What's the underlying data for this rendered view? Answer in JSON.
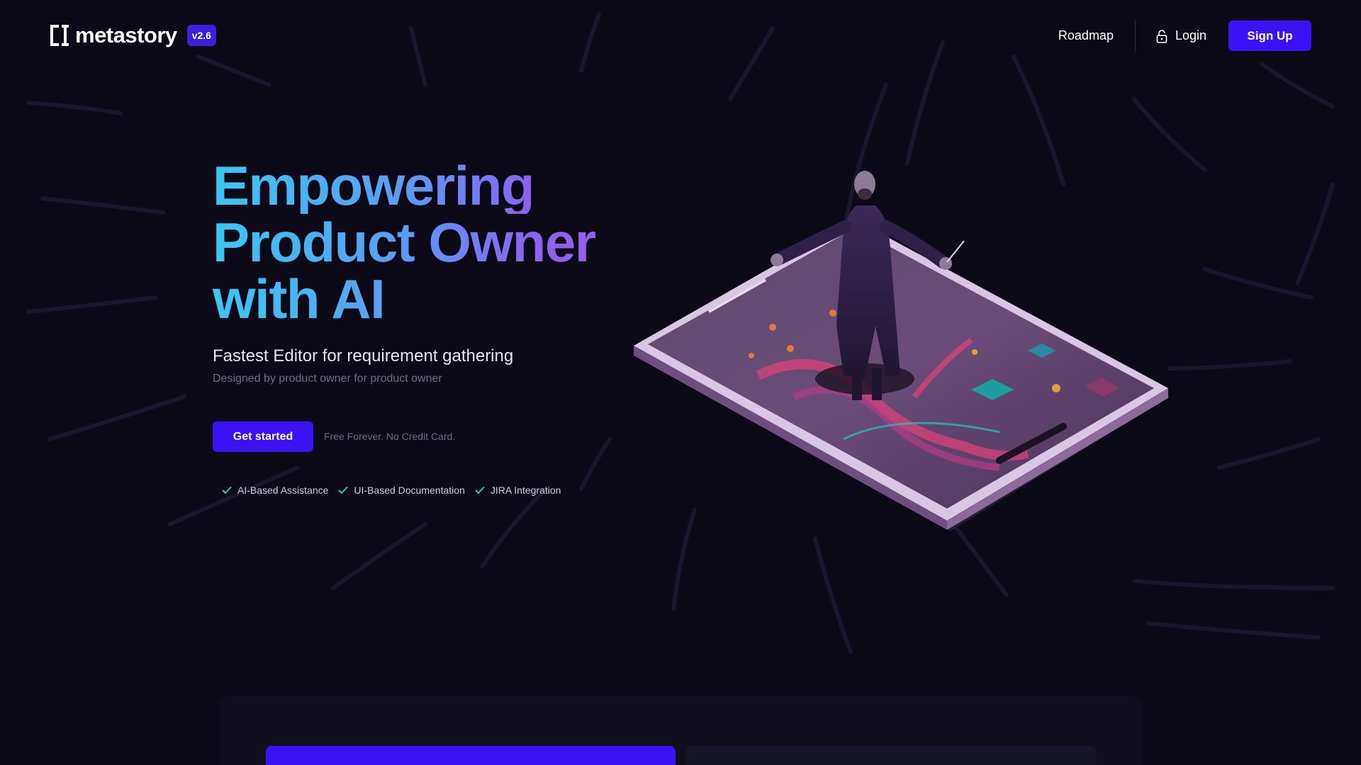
{
  "header": {
    "logo_text": "metastory",
    "version": "v2.6",
    "nav": {
      "roadmap": "Roadmap",
      "login": "Login",
      "signup": "Sign Up"
    }
  },
  "hero": {
    "title_lines": [
      "Empowering",
      "Product Owner",
      "with AI"
    ],
    "subtitle": "Fastest Editor for requirement gathering",
    "tagline": "Designed by product owner for product owner",
    "cta_label": "Get started",
    "cta_note": "Free Forever. No Credit Card.",
    "features": [
      "AI-Based Assistance",
      "UI-Based Documentation",
      "JIRA Integration"
    ]
  },
  "colors": {
    "background": "#0b0a16",
    "accent": "#3a12f5",
    "check": "#35c7a0",
    "gradient_start": "#38c8f4",
    "gradient_end": "#9d5cf0"
  },
  "icons": {
    "logo": "bracket-logo-icon",
    "lock": "lock-icon",
    "check": "check-icon"
  }
}
